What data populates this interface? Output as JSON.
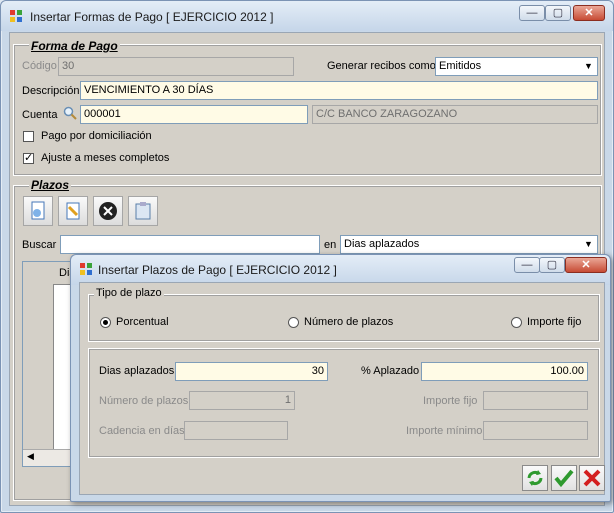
{
  "main_window": {
    "title": "Insertar Formas de Pago [ EJERCICIO 2012 ]",
    "forma_de_pago_group": "Forma de Pago",
    "codigo_label": "Código",
    "codigo_value": "30",
    "generar_label": "Generar recibos como",
    "generar_value": "Emitidos",
    "descripcion_label": "Descripción",
    "descripcion_value": "VENCIMIENTO A 30 DÍAS",
    "cuenta_label": "Cuenta",
    "cuenta_value": "000001",
    "cuenta_name": "C/C BANCO ZARAGOZANO",
    "pago_domiciliacion_label": "Pago por domiciliación",
    "pago_domiciliacion_checked": false,
    "ajuste_label": "Ajuste a meses completos",
    "ajuste_checked": true,
    "plazos_group": "Plazos",
    "buscar_label": "Buscar",
    "buscar_value": "",
    "en_label": "en",
    "en_value": "Dias aplazados",
    "grid_col_partial": "Dia"
  },
  "dialog": {
    "title": "Insertar Plazos de Pago [ EJERCICIO 2012 ]",
    "tipo_group": "Tipo de plazo",
    "radio_porcentual": "Porcentual",
    "radio_numero": "Número de plazos",
    "radio_importe": "Importe fijo",
    "selected": "Porcentual",
    "dias_aplazados_label": "Dias aplazados",
    "dias_aplazados_value": "30",
    "pct_aplazado_label": "% Aplazado",
    "pct_aplazado_value": "100.00",
    "numero_plazos_label": "Número de plazos",
    "numero_plazos_value": "1",
    "importe_fijo_label": "Importe fijo",
    "importe_fijo_value": "",
    "cadencia_label": "Cadencia en días",
    "cadencia_value": "",
    "importe_minimo_label": "Importe mínimo",
    "importe_minimo_value": ""
  },
  "window_controls": {
    "minimize": "—",
    "maximize": "▢",
    "close": "✕"
  },
  "colors": {
    "accent_input": "#fffbe6",
    "titlebar": "#c6d6e9",
    "close": "#c74b34"
  }
}
